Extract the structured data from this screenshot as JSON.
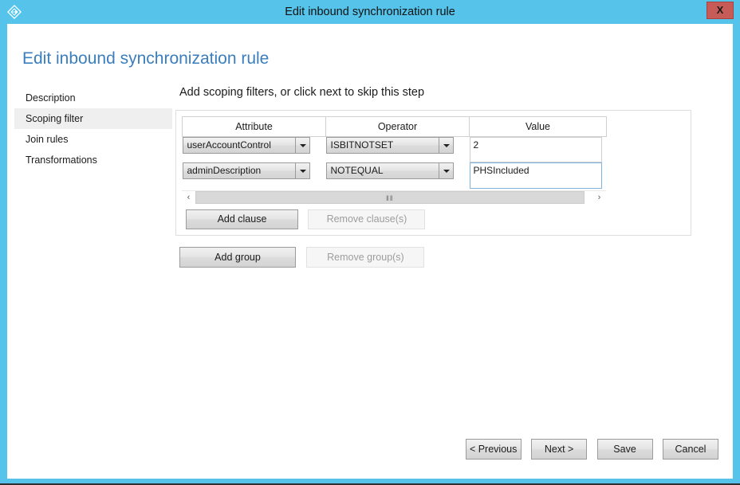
{
  "window": {
    "title": "Edit inbound synchronization rule",
    "icon": "azure-diamond-icon",
    "close_label": "X",
    "frame_color": "#55c3ea",
    "close_color": "#c75b57"
  },
  "page": {
    "title": "Edit inbound synchronization rule",
    "title_color": "#3a7ebd"
  },
  "sidebar": {
    "items": [
      {
        "label": "Description",
        "selected": false
      },
      {
        "label": "Scoping filter",
        "selected": true
      },
      {
        "label": "Join rules",
        "selected": false
      },
      {
        "label": "Transformations",
        "selected": false
      }
    ]
  },
  "main": {
    "step_heading": "Add scoping filters, or click next to skip this step",
    "table": {
      "headers": [
        "Attribute",
        "Operator",
        "Value"
      ],
      "rows": [
        {
          "attribute": "userAccountControl",
          "operator": "ISBITNOTSET",
          "value": "2",
          "value_focused": false
        },
        {
          "attribute": "adminDescription",
          "operator": "NOTEQUAL",
          "value": "PHSIncluded",
          "value_focused": true
        }
      ]
    },
    "scrollbar": {
      "left_arrow": "‹",
      "right_arrow": "›",
      "grip": "‖‖"
    },
    "clause_buttons": {
      "add": "Add clause",
      "remove": "Remove clause(s)",
      "add_enabled": true,
      "remove_enabled": false
    },
    "group_buttons": {
      "add": "Add group",
      "remove": "Remove group(s)",
      "add_enabled": true,
      "remove_enabled": false
    }
  },
  "footer": {
    "buttons": [
      {
        "label": "< Previous"
      },
      {
        "label": "Next >"
      },
      {
        "label": "Save"
      },
      {
        "label": "Cancel"
      }
    ]
  }
}
